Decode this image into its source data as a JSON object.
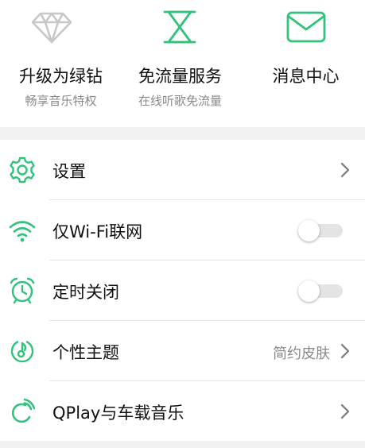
{
  "colors": {
    "accent": "#31c27c",
    "diamond": "#c8c8c8",
    "divider": "#e6e6e6",
    "section_gap": "#f2f2f2"
  },
  "shortcuts": [
    {
      "icon": "diamond-icon",
      "title": "升级为绿钻",
      "subtitle": "畅享音乐特权"
    },
    {
      "icon": "hourglass-icon",
      "title": "免流量服务",
      "subtitle": "在线听歌免流量"
    },
    {
      "icon": "envelope-icon",
      "title": "消息中心",
      "subtitle": ""
    }
  ],
  "menu": {
    "items": [
      {
        "icon": "gear-icon",
        "label": "设置",
        "control": "chevron"
      },
      {
        "icon": "wifi-icon",
        "label": "仅Wi-Fi联网",
        "control": "toggle",
        "enabled": false
      },
      {
        "icon": "alarm-clock-icon",
        "label": "定时关闭",
        "control": "toggle",
        "enabled": false
      },
      {
        "icon": "theme-icon",
        "label": "个性主题",
        "control": "chevron",
        "value": "简约皮肤"
      },
      {
        "icon": "qplay-icon",
        "label": "QPlay与车载音乐",
        "control": "chevron"
      }
    ]
  }
}
